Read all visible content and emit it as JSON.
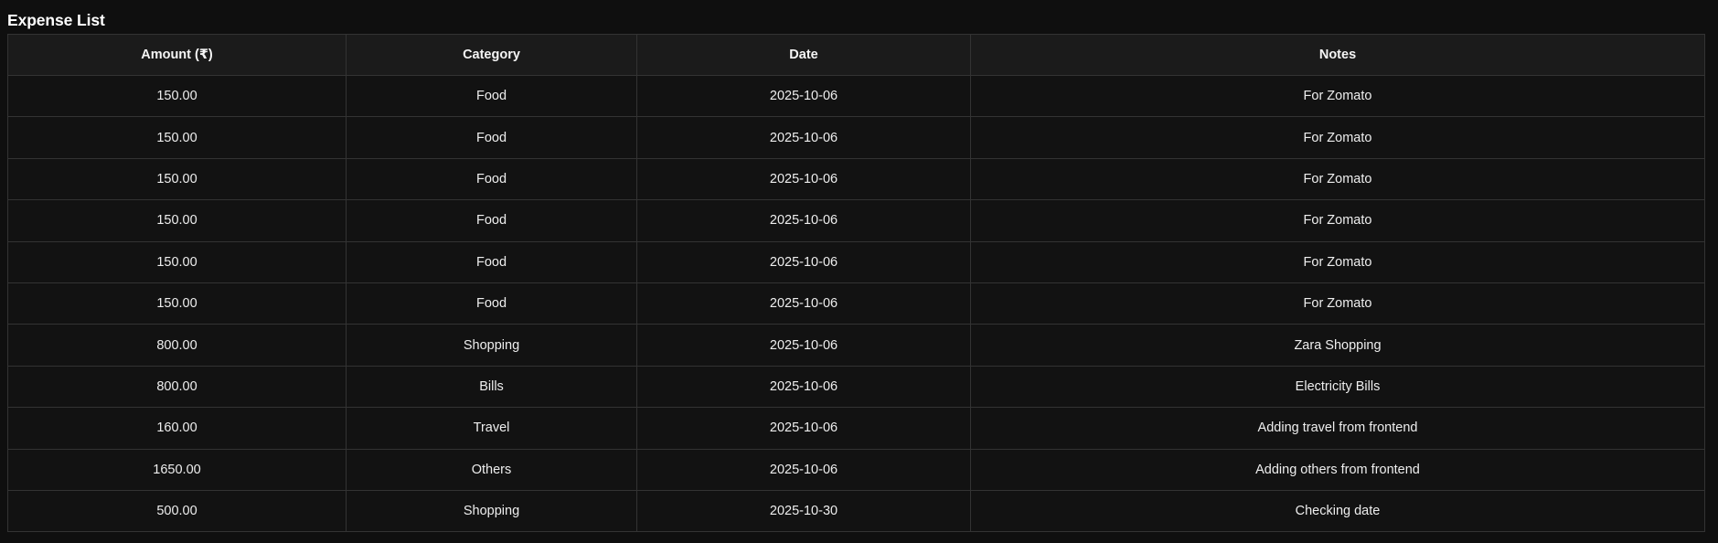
{
  "page": {
    "title": "Expense List"
  },
  "table": {
    "headers": {
      "amount": "Amount (₹)",
      "category": "Category",
      "date": "Date",
      "notes": "Notes"
    },
    "rows": [
      {
        "amount": "150.00",
        "category": "Food",
        "date": "2025-10-06",
        "notes": "For Zomato"
      },
      {
        "amount": "150.00",
        "category": "Food",
        "date": "2025-10-06",
        "notes": "For Zomato"
      },
      {
        "amount": "150.00",
        "category": "Food",
        "date": "2025-10-06",
        "notes": "For Zomato"
      },
      {
        "amount": "150.00",
        "category": "Food",
        "date": "2025-10-06",
        "notes": "For Zomato"
      },
      {
        "amount": "150.00",
        "category": "Food",
        "date": "2025-10-06",
        "notes": "For Zomato"
      },
      {
        "amount": "150.00",
        "category": "Food",
        "date": "2025-10-06",
        "notes": "For Zomato"
      },
      {
        "amount": "800.00",
        "category": "Shopping",
        "date": "2025-10-06",
        "notes": "Zara Shopping"
      },
      {
        "amount": "800.00",
        "category": "Bills",
        "date": "2025-10-06",
        "notes": "Electricity Bills"
      },
      {
        "amount": "160.00",
        "category": "Travel",
        "date": "2025-10-06",
        "notes": "Adding travel from frontend"
      },
      {
        "amount": "1650.00",
        "category": "Others",
        "date": "2025-10-06",
        "notes": "Adding others from frontend"
      },
      {
        "amount": "500.00",
        "category": "Shopping",
        "date": "2025-10-30",
        "notes": "Checking date"
      }
    ]
  },
  "colors": {
    "background": "#0f0f0f",
    "table_background": "#121212",
    "header_background": "#1b1b1b",
    "border": "#333333",
    "text": "#eeeeee"
  }
}
